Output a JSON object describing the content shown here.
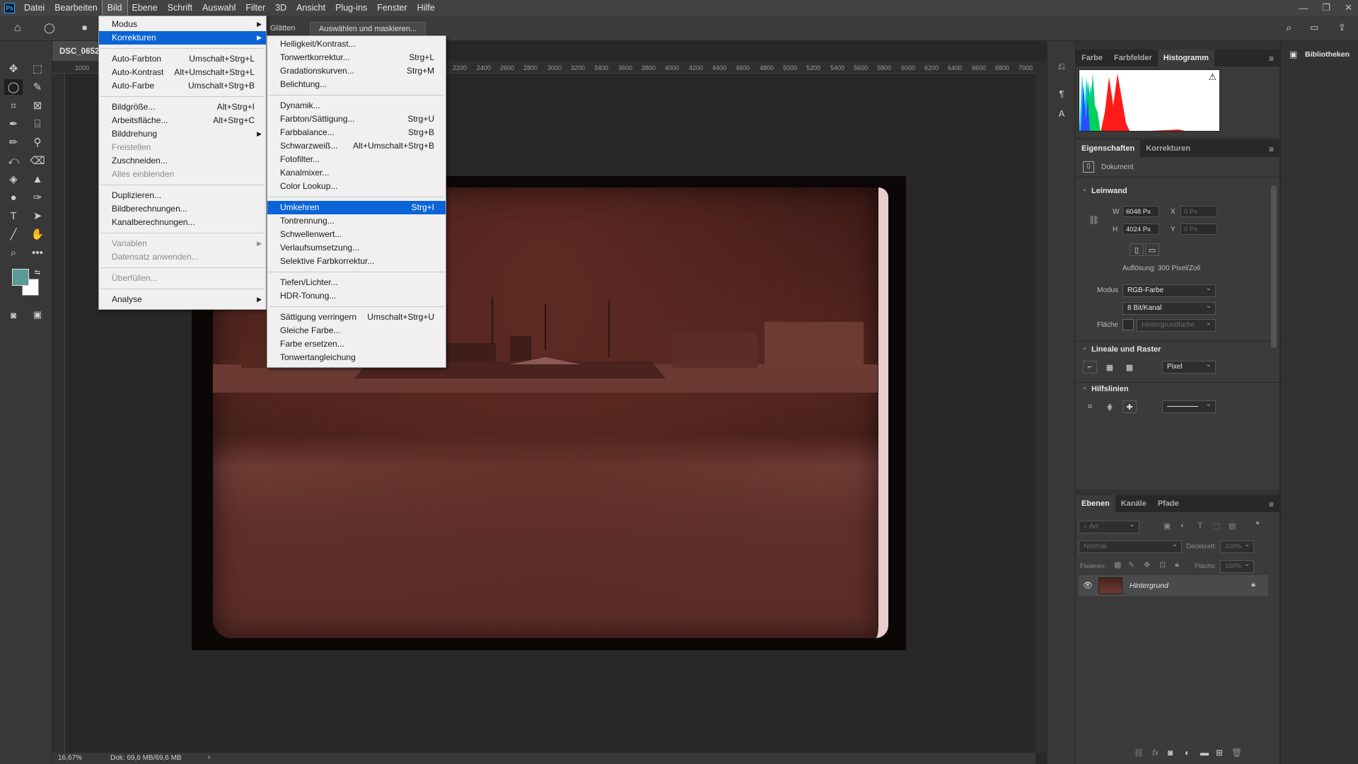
{
  "menubar": {
    "logo": "Ps",
    "items": [
      "Datei",
      "Bearbeiten",
      "Bild",
      "Ebene",
      "Schrift",
      "Auswahl",
      "Filter",
      "3D",
      "Ansicht",
      "Plug-ins",
      "Fenster",
      "Hilfe"
    ],
    "active": "Bild"
  },
  "optionsbar": {
    "smooth_label": "Glätten",
    "select_mask_label": "Auswählen und maskieren..."
  },
  "document": {
    "tab_title": "DSC_0652.",
    "ruler_h": [
      "1000",
      "2200",
      "2400",
      "2600",
      "2800",
      "3000",
      "3200",
      "3400",
      "3600",
      "3800",
      "4000",
      "4200",
      "4400",
      "4600",
      "4800",
      "5000",
      "5200",
      "5400",
      "5600",
      "5800",
      "6000",
      "6200",
      "6400",
      "6600",
      "6800",
      "7000"
    ],
    "zoom": "16,67%",
    "doc_size": "Dok: 69,6 MB/69,6 MB"
  },
  "bild_menu": [
    {
      "label": "Modus",
      "submenu": true
    },
    {
      "label": "Korrekturen",
      "submenu": true,
      "highlighted": true
    },
    {
      "sep": true
    },
    {
      "label": "Auto-Farbton",
      "shortcut": "Umschalt+Strg+L"
    },
    {
      "label": "Auto-Kontrast",
      "shortcut": "Alt+Umschalt+Strg+L"
    },
    {
      "label": "Auto-Farbe",
      "shortcut": "Umschalt+Strg+B"
    },
    {
      "sep": true
    },
    {
      "label": "Bildgröße...",
      "shortcut": "Alt+Strg+I"
    },
    {
      "label": "Arbeitsfläche...",
      "shortcut": "Alt+Strg+C"
    },
    {
      "label": "Bilddrehung",
      "submenu": true
    },
    {
      "label": "Freistellen",
      "disabled": true
    },
    {
      "label": "Zuschneiden..."
    },
    {
      "label": "Alles einblenden",
      "disabled": true
    },
    {
      "sep": true
    },
    {
      "label": "Duplizieren..."
    },
    {
      "label": "Bildberechnungen..."
    },
    {
      "label": "Kanalberechnungen..."
    },
    {
      "sep": true
    },
    {
      "label": "Variablen",
      "submenu": true,
      "disabled": true
    },
    {
      "label": "Datensatz anwenden...",
      "disabled": true
    },
    {
      "sep": true
    },
    {
      "label": "Überfüllen...",
      "disabled": true
    },
    {
      "sep": true
    },
    {
      "label": "Analyse",
      "submenu": true
    }
  ],
  "korrekturen_menu": [
    {
      "label": "Helligkeit/Kontrast..."
    },
    {
      "label": "Tonwertkorrektur...",
      "shortcut": "Strg+L"
    },
    {
      "label": "Gradationskurven...",
      "shortcut": "Strg+M"
    },
    {
      "label": "Belichtung..."
    },
    {
      "sep": true
    },
    {
      "label": "Dynamik..."
    },
    {
      "label": "Farbton/Sättigung...",
      "shortcut": "Strg+U"
    },
    {
      "label": "Farbbalance...",
      "shortcut": "Strg+B"
    },
    {
      "label": "Schwarzweiß...",
      "shortcut": "Alt+Umschalt+Strg+B"
    },
    {
      "label": "Fotofilter..."
    },
    {
      "label": "Kanalmixer..."
    },
    {
      "label": "Color Lookup..."
    },
    {
      "sep": true
    },
    {
      "label": "Umkehren",
      "shortcut": "Strg+I",
      "highlighted": true
    },
    {
      "label": "Tontrennung..."
    },
    {
      "label": "Schwellenwert..."
    },
    {
      "label": "Verlaufsumsetzung..."
    },
    {
      "label": "Selektive Farbkorrektur..."
    },
    {
      "sep": true
    },
    {
      "label": "Tiefen/Lichter..."
    },
    {
      "label": "HDR-Tonung..."
    },
    {
      "sep": true
    },
    {
      "label": "Sättigung verringern",
      "shortcut": "Umschalt+Strg+U"
    },
    {
      "label": "Gleiche Farbe..."
    },
    {
      "label": "Farbe ersetzen..."
    },
    {
      "label": "Tonwertangleichung"
    }
  ],
  "histogram_panel": {
    "tabs": [
      "Farbe",
      "Farbfelder",
      "Histogramm"
    ],
    "active": "Histogramm",
    "warning": "⚠"
  },
  "properties_panel": {
    "tabs": [
      "Eigenschaften",
      "Korrekturen"
    ],
    "active": "Eigenschaften",
    "doc_label": "Dokument",
    "canvas_section": "Leinwand",
    "w_label": "W",
    "w_value": "6048 Px",
    "h_label": "H",
    "h_value": "4024 Px",
    "x_label": "X",
    "x_value": "0 Px",
    "y_label": "Y",
    "y_value": "0 Px",
    "resolution": "Auflösung: 300 Pixel/Zoll",
    "mode_label": "Modus",
    "mode_value": "RGB-Farbe",
    "bits_value": "8 Bit/Kanal",
    "fill_label": "Fläche",
    "fill_value": "Hintergrundfarbe",
    "rulers_section": "Lineale und Raster",
    "units_value": "Pixel",
    "guides_section": "Hilfslinien"
  },
  "layers_panel": {
    "tabs": [
      "Ebenen",
      "Kanäle",
      "Pfade"
    ],
    "active": "Ebenen",
    "filter_placeholder": "Art",
    "blend_mode": "Normal",
    "opacity_label": "Deckkraft:",
    "opacity_value": "100%",
    "lock_label": "Fixieren:",
    "fill_label": "Fläche:",
    "fill_value": "100%",
    "layer_name": "Hintergrund"
  },
  "libraries_panel": {
    "title": "Bibliotheken"
  },
  "colors": {
    "foreground": "#5b9a96",
    "background": "#ffffff",
    "menu_highlight": "#0a64d6"
  }
}
